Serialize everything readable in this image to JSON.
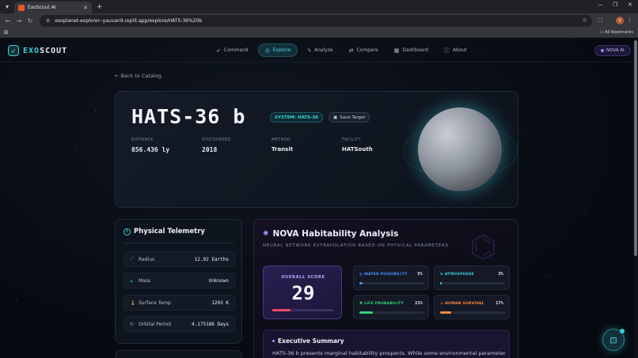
{
  "browser": {
    "tab_title": "ExoScout AI",
    "url": "exoplanet-explorer--yauvan9.replit.app/explore/HATS-36%20b",
    "all_bookmarks": "All Bookmarks",
    "avatar_letter": "Y"
  },
  "nav": {
    "brand_prefix": "EXO",
    "brand_suffix": "SCOUT",
    "items": [
      {
        "label": "Command",
        "icon": "rocket-icon"
      },
      {
        "label": "Explore",
        "icon": "globe-icon",
        "active": true
      },
      {
        "label": "Analyze",
        "icon": "pulse-icon"
      },
      {
        "label": "Compare",
        "icon": "compare-icon"
      },
      {
        "label": "Dashboard",
        "icon": "grid-icon"
      },
      {
        "label": "About",
        "icon": "info-icon"
      }
    ],
    "assistant": "NOVA AI"
  },
  "back_link": "Back to Catalog",
  "planet": {
    "name": "HATS-36 b",
    "system_badge": "SYSTEM: HATS-36",
    "save_label": "Save Target",
    "stats": [
      {
        "label": "DISTANCE",
        "value": "856.436 ly"
      },
      {
        "label": "DISCOVERED",
        "value": "2018"
      },
      {
        "label": "METHOD",
        "value": "Transit"
      },
      {
        "label": "FACILITY",
        "value": "HATSouth"
      }
    ]
  },
  "telemetry": {
    "title": "Physical Telemetry",
    "rows": [
      {
        "label": "Radius",
        "value": "12.92 Earths",
        "icon": "ruler-icon"
      },
      {
        "label": "Mass",
        "value": "Unknown",
        "icon": "scale-icon"
      },
      {
        "label": "Surface Temp",
        "value": "1203 K",
        "icon": "thermometer-icon"
      },
      {
        "label": "Orbital Period",
        "value": "4.175186 Days",
        "icon": "orbit-icon"
      }
    ]
  },
  "analysis": {
    "title": "NOVA Habitability Analysis",
    "subtitle": "NEURAL NETWORK EXTRAPOLATION BASED ON PHYSICAL PARAMETERS",
    "score_label": "OVERALL SCORE",
    "score": "29",
    "score_fraction": 0.29,
    "metrics": [
      {
        "label": "WATER POSSIBILITY",
        "value": "5%",
        "fraction": 0.05,
        "color": "#4a8dff"
      },
      {
        "label": "ATMOSPHERE",
        "value": "3%",
        "fraction": 0.03,
        "color": "#3ad1d9"
      },
      {
        "label": "LIFE PROBABILITY",
        "value": "21%",
        "fraction": 0.21,
        "color": "#2fd17a"
      },
      {
        "label": "HUMAN SURVIVAL",
        "value": "17%",
        "fraction": 0.17,
        "color": "#ff8a3d"
      }
    ],
    "summary_title": "Executive Summary",
    "summary_text": "HATS-36 b presents marginal habitability prospects. While some environmental parameters"
  },
  "colors": {
    "accent": "#3ad1d9",
    "nova": "#a98bff",
    "score_bar": "#f24a63"
  }
}
